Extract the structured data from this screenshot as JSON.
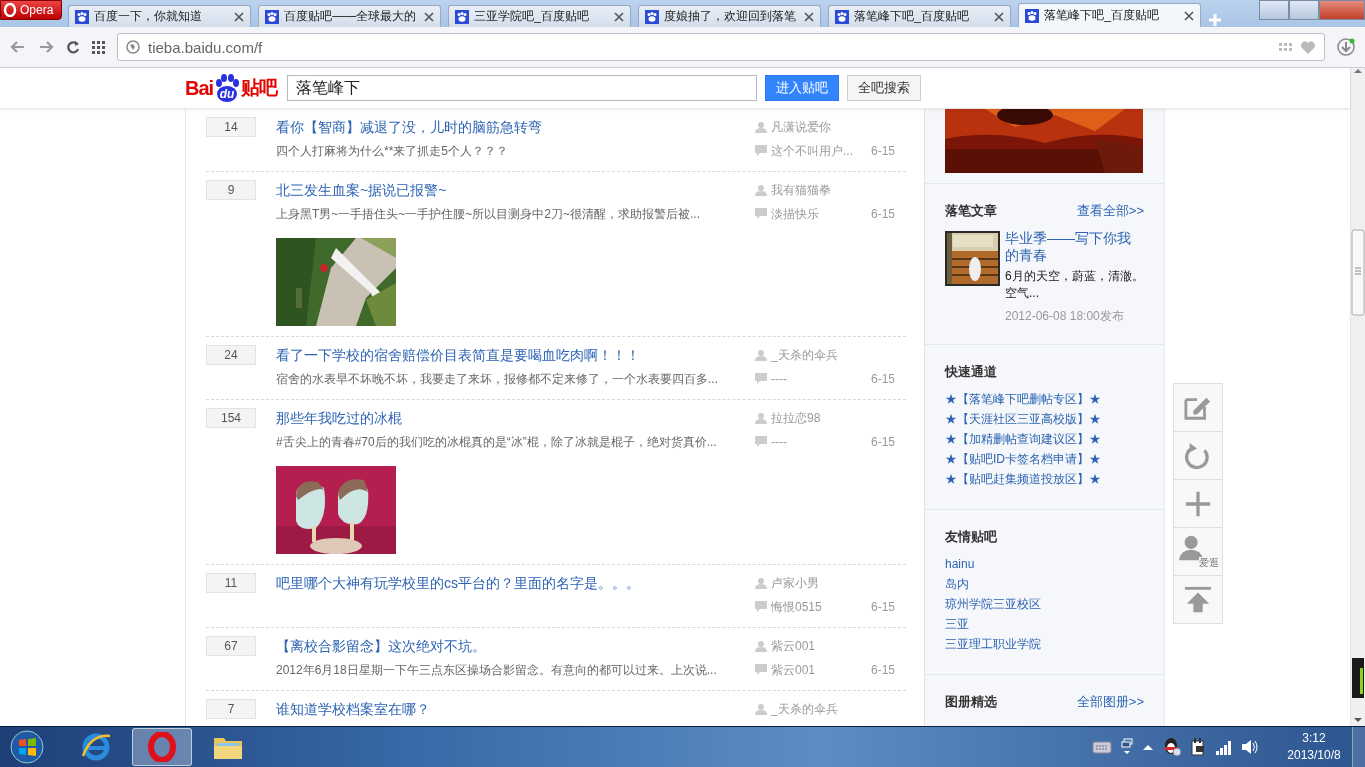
{
  "browser": {
    "menu_label": "Opera",
    "tabs": [
      {
        "title": "百度一下，你就知道",
        "selected": false
      },
      {
        "title": "百度贴吧——全球最大的",
        "selected": false
      },
      {
        "title": "三亚学院吧_百度贴吧",
        "selected": false
      },
      {
        "title": "度娘抽了，欢迎回到落笔",
        "selected": false
      },
      {
        "title": "落笔峰下吧_百度贴吧",
        "selected": false
      },
      {
        "title": "落笔峰下吧_百度贴吧",
        "selected": true
      }
    ],
    "address": "tieba.baidu.com/f"
  },
  "header": {
    "logo": {
      "left": "Bai",
      "paw": "du",
      "right": "贴吧"
    },
    "search_value": "落笔峰下",
    "buttons": [
      {
        "label": "进入贴吧",
        "kind": "primary"
      },
      {
        "label": "全吧搜索",
        "kind": "secondary"
      }
    ]
  },
  "threads": [
    {
      "replies": "14",
      "title": "看你【智商】减退了没，儿时的脑筋急转弯",
      "snippet": "四个人打麻将为什么**来了抓走5个人？？？",
      "author": "凡潇说爱你",
      "last_reply": "这个不叫用户...",
      "date": "6-15"
    },
    {
      "replies": "9",
      "title": "北三发生血案~据说已报警~",
      "snippet": "上身黑T男~一手捂住头~一手护住腰~所以目测身中2刀~很清醒，求助报警后被...",
      "author": "我有猫猫拳",
      "last_reply": "淡描快乐",
      "date": "6-15",
      "picture": {
        "kind": "aerial"
      }
    },
    {
      "replies": "24",
      "title": "看了一下学校的宿舍赔偿价目表简直是要喝血吃肉啊！！！",
      "snippet": "宿舍的水表早不坏晚不坏，我要走了来坏，报修都不定来修了，一个水表要四百多...",
      "author": "_天杀的伞兵",
      "last_reply": "----",
      "date": "6-15"
    },
    {
      "replies": "154",
      "title": "那些年我吃过的冰棍",
      "snippet": "#舌尖上的青春#70后的我们吃的冰棍真的是“冰”棍，除了冰就是棍子，绝对货真价...",
      "author": "拉拉恋98",
      "last_reply": "----",
      "date": "6-15",
      "picture": {
        "kind": "popsicles"
      }
    },
    {
      "replies": "11",
      "title": "吧里哪个大神有玩学校里的cs平台的？里面的名字是。。。",
      "author": "卢家小男",
      "last_reply": "悔恨0515",
      "date": "6-15"
    },
    {
      "replies": "67",
      "title": "【离校合影留念】这次绝对不坑。",
      "snippet": "2012年6月18日星期一下午三点东区操场合影留念。有意向的都可以过来。上次说...",
      "author": "紫云001",
      "last_reply": "紫云001",
      "date": "6-15"
    },
    {
      "replies": "7",
      "title": "谁知道学校档案室在哪？",
      "author": "_天杀的伞兵"
    }
  ],
  "sidebar": {
    "articles": {
      "heading": "落笔文章",
      "more": "查看全部>>",
      "title": "毕业季——写下你我的青春",
      "snippet": "6月的天空，蔚蓝，清澈。空气...",
      "date": "2012-06-08 18:00发布"
    },
    "quick_links": {
      "heading": "快速通道",
      "items": [
        "★【落笔峰下吧删帖专区】★",
        "★【天涯社区三亚高校版】★",
        "★【加精删帖查询建议区】★",
        "★【贴吧ID卡签名档申请】★",
        "★【贴吧赶集频道投放区】★"
      ]
    },
    "friend_bars": {
      "heading": "友情贴吧",
      "items": [
        "hainu",
        "岛内",
        "琼州学院三亚校区",
        "三亚",
        "三亚理工职业学院"
      ]
    },
    "albums": {
      "heading": "图册精选",
      "more": "全部图册>>"
    }
  },
  "float_tools": [
    {
      "kind": "edit"
    },
    {
      "kind": "refresh"
    },
    {
      "kind": "add"
    },
    {
      "kind": "user",
      "label": "爱逛"
    },
    {
      "kind": "top"
    }
  ],
  "taskbar": {
    "apps": [
      {
        "kind": "ie",
        "selected": false
      },
      {
        "kind": "opera",
        "selected": true
      },
      {
        "kind": "folder",
        "selected": false
      }
    ],
    "time": "3:12",
    "date": "2013/10/8"
  }
}
